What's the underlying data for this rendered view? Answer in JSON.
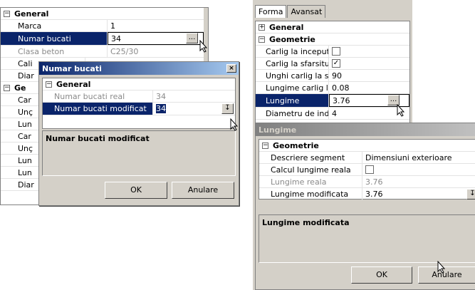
{
  "left_grid": {
    "category": "General",
    "rows": [
      {
        "name": "Marca",
        "value": "1"
      },
      {
        "name": "Numar bucati",
        "value": "34"
      },
      {
        "name": "Clasa beton",
        "value": "C25/30"
      },
      {
        "name": "Cali",
        "value": ""
      },
      {
        "name": "Diar",
        "value": ""
      },
      {
        "name": "Car",
        "value": ""
      },
      {
        "name": "Unç",
        "value": ""
      },
      {
        "name": "Lun",
        "value": ""
      },
      {
        "name": "Car",
        "value": ""
      },
      {
        "name": "Unç",
        "value": ""
      },
      {
        "name": "Lun",
        "value": ""
      },
      {
        "name": "Lun",
        "value": ""
      },
      {
        "name": "Diar",
        "value": ""
      }
    ],
    "category2": "Ge",
    "dd_symbol": "..."
  },
  "dialog1": {
    "title": "Numar bucati",
    "close": "×",
    "category": "General",
    "rows": [
      {
        "name": "Numar bucati real",
        "value": "34"
      },
      {
        "name": "Numar bucati modificat",
        "value": "34"
      }
    ],
    "description": "Numar bucati modificat",
    "ok": "OK",
    "cancel": "Anulare",
    "dd_symbol": "↧"
  },
  "right_panel": {
    "tabs": [
      "Forma",
      "Avansat"
    ],
    "cat1": "General",
    "cat2": "Geometrie",
    "rows": [
      {
        "name": "Carlig la inceputul",
        "value": "",
        "check": ""
      },
      {
        "name": "Carlig la sfarsitul b",
        "value": "",
        "check": "✓"
      },
      {
        "name": "Unghi carlig la sfa",
        "value": "90"
      },
      {
        "name": "Lungime carlig la s",
        "value": "0.08"
      },
      {
        "name": "Lungime",
        "value": "3.76"
      },
      {
        "name": "Diametru de indoir",
        "value": "4"
      }
    ],
    "dd_symbol": "..."
  },
  "dialog2": {
    "title": "Lungime",
    "category": "Geometrie",
    "rows": [
      {
        "name": "Descriere segment",
        "value": "Dimensiuni exterioare"
      },
      {
        "name": "Calcul lungime reala",
        "value": ""
      },
      {
        "name": "Lungime reala",
        "value": "3.76"
      },
      {
        "name": "Lungime modificata",
        "value": "3.76"
      }
    ],
    "description": "Lungime modificata",
    "ok": "OK",
    "cancel": "Anulare",
    "dd_symbol": "↧"
  },
  "colors": {
    "selection": "#0a246a",
    "dialog_bg": "#d4d0c8"
  }
}
